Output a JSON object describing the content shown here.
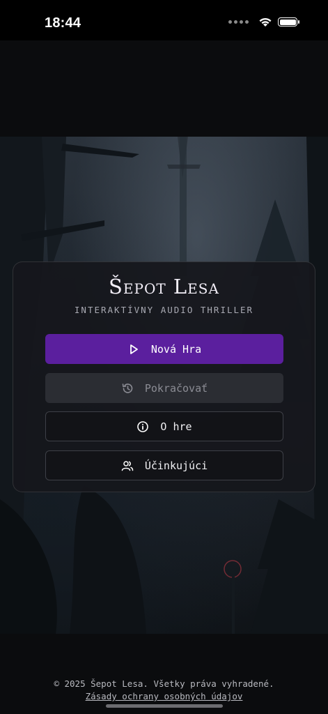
{
  "status_bar": {
    "time": "18:44"
  },
  "menu": {
    "title": "Šepot Lesa",
    "subtitle": "INTERAKTÍVNY AUDIO THRILLER",
    "buttons": {
      "new_game": {
        "label": "Nová Hra",
        "icon": "play-icon"
      },
      "continue": {
        "label": "Pokračovať",
        "icon": "history-icon"
      },
      "about": {
        "label": "O hre",
        "icon": "info-icon"
      },
      "credits": {
        "label": "Účinkujúci",
        "icon": "users-icon"
      }
    }
  },
  "footer": {
    "copyright": "© 2025 Šepot Lesa. Všetky práva vyhradené.",
    "privacy_link": "Zásady ochrany osobných údajov"
  },
  "colors": {
    "accent": "#5b1f9e",
    "background": "#0b0c0e",
    "card": "#16171c",
    "disabled": "#2b2d33"
  }
}
